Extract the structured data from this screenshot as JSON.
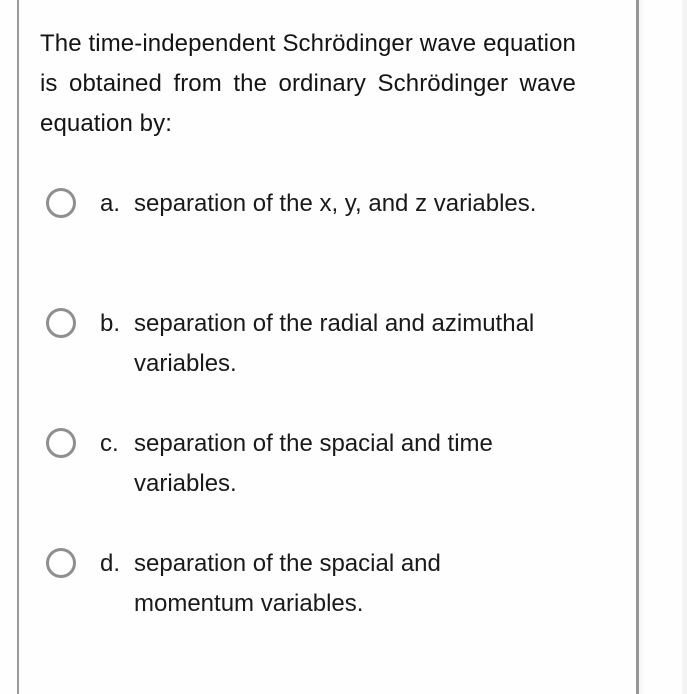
{
  "question": {
    "text": "The time-independent Schrödinger wave equation is obtained from the ordinary Schrödinger wave equation by:"
  },
  "options": [
    {
      "letter": "a.",
      "text": "separation of the x, y, and z variables.",
      "selected": false
    },
    {
      "letter": "b.",
      "text": "separation of the radial and azimuthal variables.",
      "selected": false
    },
    {
      "letter": "c.",
      "text": "separation of the spacial and time variables.",
      "selected": false
    },
    {
      "letter": "d.",
      "text": "separation of the spacial and momentum variables.",
      "selected": false
    }
  ],
  "colors": {
    "text": "#1a1a1a",
    "radio_border": "#8f8f8f",
    "card_border": "#9a9a9a",
    "background": "#fefefe"
  }
}
